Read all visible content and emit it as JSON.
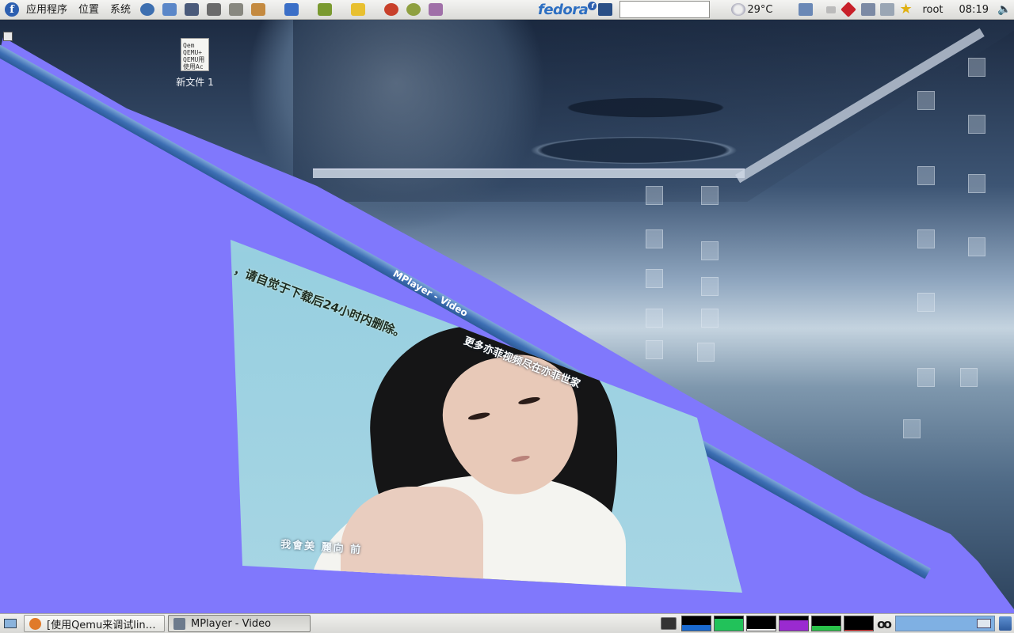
{
  "top_panel": {
    "menus": [
      "应用程序",
      "位置",
      "系统"
    ],
    "launchers": [
      {
        "name": "globe-icon",
        "color": "#3d6fb0"
      },
      {
        "name": "network-icon",
        "color": "#5b87c8"
      },
      {
        "name": "screen-icon",
        "color": "#4a5a7a"
      },
      {
        "name": "disk-icon",
        "color": "#6b6b6b"
      },
      {
        "name": "printer-icon",
        "color": "#888880"
      },
      {
        "name": "hand-icon",
        "color": "#c48a40"
      },
      {
        "name": "help-icon",
        "color": "#3b6fc7"
      },
      {
        "name": "book-icon",
        "color": "#7a9a30"
      },
      {
        "name": "notes-icon",
        "color": "#e8c030"
      },
      {
        "name": "red-apple-icon",
        "color": "#c8402a"
      },
      {
        "name": "green-apple-icon",
        "color": "#8fa040"
      },
      {
        "name": "house-icon",
        "color": "#a070a8"
      }
    ],
    "logo_text": "fedora",
    "weather": "29°C",
    "user": "root",
    "clock": "08:19"
  },
  "desktop": {
    "icons": [
      {
        "label": "新文件 1",
        "preview_lines": [
          "Qem",
          "QEMU+",
          "QEMU用",
          "使用Ac"
        ]
      }
    ]
  },
  "video_window": {
    "title": "MPlayer - Video",
    "subtitle_top": "，请自觉于下载后24小时内删除。",
    "subtitle_mid": "更多亦菲视频尽在亦菲世家",
    "subtitle_bottom": "我會美  麗向  前"
  },
  "taskbar": {
    "tasks": [
      {
        "label": "[使用Qemu来调试lin…",
        "active": false,
        "icon_color": "#e07a2a"
      },
      {
        "label": "MPlayer - Video",
        "active": true,
        "icon_color": "#6c7a8c"
      }
    ],
    "monitors": [
      {
        "name": "cpu-monitor",
        "color": "#1a6ad0",
        "level": 0.4
      },
      {
        "name": "mem-monitor",
        "color": "#22c25a",
        "level": 0.85
      },
      {
        "name": "net-monitor",
        "color": "#ffffff",
        "level": 0.1
      },
      {
        "name": "swap-monitor",
        "color": "#9a2ad0",
        "level": 0.75
      },
      {
        "name": "load-monitor",
        "color": "#2ac24a",
        "level": 0.35
      },
      {
        "name": "disk-monitor",
        "color": "#e03030",
        "level": 0.05
      }
    ]
  }
}
